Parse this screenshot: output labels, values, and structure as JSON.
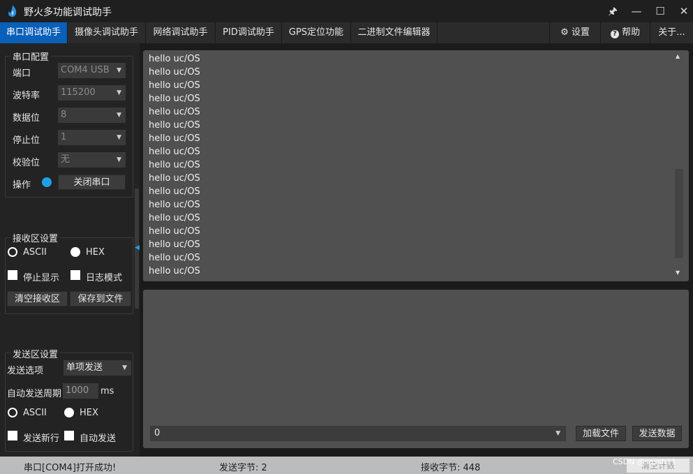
{
  "window": {
    "title": "野火多功能调试助手",
    "controls": {
      "pin": "🖈",
      "minimize": "—",
      "maximize": "☐",
      "close": "✕"
    }
  },
  "tabs": [
    {
      "label": "串口调试助手",
      "active": true
    },
    {
      "label": "摄像头调试助手"
    },
    {
      "label": "网络调试助手"
    },
    {
      "label": "PID调试助手"
    },
    {
      "label": "GPS定位功能"
    },
    {
      "label": "二进制文件编辑器"
    }
  ],
  "right_tabs": {
    "settings": "设置",
    "help": "帮助",
    "about": "关于..."
  },
  "serial_config": {
    "title": "串口配置",
    "port_label": "端口",
    "port_value": "COM4 USB",
    "baud_label": "波特率",
    "baud_value": "115200",
    "databits_label": "数据位",
    "databits_value": "8",
    "stopbits_label": "停止位",
    "stopbits_value": "1",
    "parity_label": "校验位",
    "parity_value": "无",
    "op_label": "操作",
    "op_button": "关闭串口"
  },
  "recv_settings": {
    "title": "接收区设置",
    "ascii": "ASCII",
    "hex": "HEX",
    "stop_display": "停止显示",
    "log_mode": "日志模式",
    "clear_button": "清空接收区",
    "save_button": "保存到文件"
  },
  "send_settings": {
    "title": "发送区设置",
    "option_label": "发送选项",
    "option_value": "单项发送",
    "period_label": "自动发送周期",
    "period_value": "1000",
    "period_unit": "ms",
    "ascii": "ASCII",
    "hex": "HEX",
    "newline": "发送新行",
    "auto_send": "自动发送"
  },
  "receive_lines": [
    "hello uc/OS",
    "hello uc/OS",
    "hello uc/OS",
    "hello uc/OS",
    "hello uc/OS",
    "hello uc/OS",
    "hello uc/OS",
    "hello uc/OS",
    "hello uc/OS",
    "hello uc/OS",
    "hello uc/OS",
    "hello uc/OS",
    "hello uc/OS",
    "hello uc/OS",
    "hello uc/OS",
    "hello uc/OS",
    "hello uc/OS"
  ],
  "send_bar": {
    "input_value": "0",
    "load_file": "加载文件",
    "send_data": "发送数据"
  },
  "status": {
    "message": "串口[COM4]打开成功!",
    "sent": "发送字节: 2",
    "received": "接收字节: 448",
    "clear_counts": "清空计数",
    "watermark": "CSDN @sgssh11"
  },
  "colors": {
    "accent": "#0a5fb8",
    "indicator": "#1ea0e6"
  }
}
